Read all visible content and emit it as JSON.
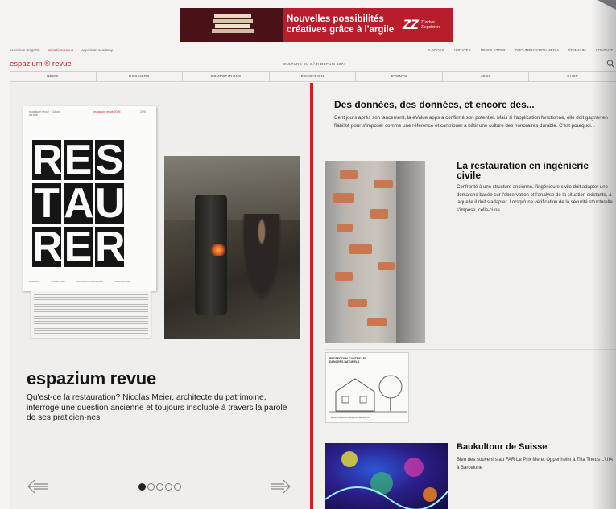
{
  "ad": {
    "headline_line1": "Nouvelles possibilités",
    "headline_line2": "créatives grâce à l'argile",
    "logo_mark": "ZZ",
    "logo_sub": "Zürcher Ziegeleien"
  },
  "toplinks": {
    "left": [
      "espazium magazin",
      "espazium revue",
      "espazium academy"
    ],
    "right": [
      "E-BOOKS",
      "UPDATES",
      "NEWSLETTER",
      "DOCUMENTATION MÉDIA",
      "ÉDIMNUM",
      "CONTACT"
    ]
  },
  "brand": {
    "name": "espazium ® revue",
    "tagline": "CULTURE DU BÂTI DEPUIS 1874"
  },
  "nav": [
    "NEWS",
    "DOSSIERS",
    "COMPETITIONS",
    "ÉDUCATION",
    "EVENTS",
    "JOBS",
    "SHOP"
  ],
  "magazine": {
    "header": "espazium revue · Culture du bâti",
    "issue": "espazium revue 2025",
    "number": "2/25",
    "letters_row1": [
      "R",
      "E",
      "S"
    ],
    "letters_row2": [
      "T",
      "A",
      "U"
    ],
    "letters_row3": [
      "R",
      "E",
      "R"
    ],
    "footer": [
      "Restaurer",
      "Nicolas Meier",
      "Architecte du patrimoine",
      "Culture du bâti"
    ]
  },
  "feature": {
    "title": "espazium revue",
    "text": "Qu'est-ce la restauration? Nicolas Meier, architecte du patrimoine, interroge une question ancienne et toujours insoluble à travers la parole de ses praticien·nes."
  },
  "carousel": {
    "count": 5,
    "active": 0
  },
  "articles": [
    {
      "title": "Des données, des données, et encore des...",
      "text": "Cent jours après son lancement, la eValue apps a confirmé son potentiel. Mais si l'application fonctionne, elle doit gagner en fiabilité pour s'imposer comme une référence et contribuer à bâtir une culture des honoraires durable. C'est pourquoi..."
    },
    {
      "title": "La restauration en ingénierie civile",
      "text": "Confronté à une structure ancienne, l'ingénieure civile doit adapter une démarche basée sur l'observation et l'analyse de la situation existante, à laquelle il doit s'adapter. Lorsqu'une vérification de la sécurité structurelle s'impose, celle-ci ne..."
    },
    {
      "badge": "PROTECTION CONTRE LES DANGERS NATURELS",
      "url": "www.protection-dangers-naturels.ch"
    },
    {
      "title": "Baukultour de Suisse",
      "text": "Bien des souvenirs au FAR Le Prix Meret Oppenheim à Tilla Theus L'UIA à Barcelone"
    }
  ]
}
